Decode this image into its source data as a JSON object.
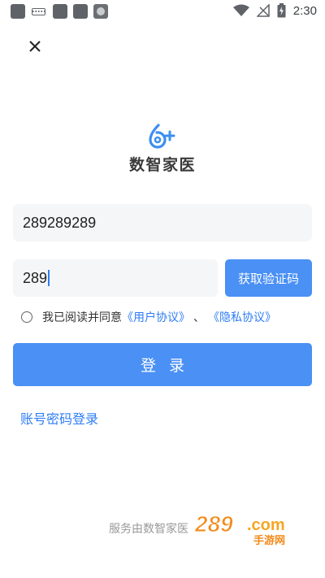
{
  "status_bar": {
    "time": "2:30",
    "icons": [
      "notification-square-icon",
      "keyboard-icon",
      "notification-square-icon",
      "notification-square-icon",
      "app-badge-icon",
      "wifi-icon",
      "no-signal-icon",
      "battery-charging-icon"
    ]
  },
  "logo": {
    "brand_name": "数智家医",
    "colors": {
      "mark": "#3d8ef0",
      "text": "#3a3a3a"
    }
  },
  "form": {
    "phone_value": "289289289",
    "code_value": "289",
    "get_code_label": "获取验证码",
    "agree_prefix": "我已阅读并同意",
    "user_agreement": "《用户协议》",
    "separator": "、",
    "privacy_agreement": "《隐私协议》",
    "agree_checked": false,
    "login_label": "登录",
    "account_login_label": "账号密码登录"
  },
  "footer": {
    "text": "服务由数智家医",
    "watermark_text": "289.com",
    "watermark_subtext": "手游网"
  },
  "colors": {
    "accent": "#4a90f5",
    "link": "#2e7cf6",
    "field_bg": "#f5f6f8"
  }
}
